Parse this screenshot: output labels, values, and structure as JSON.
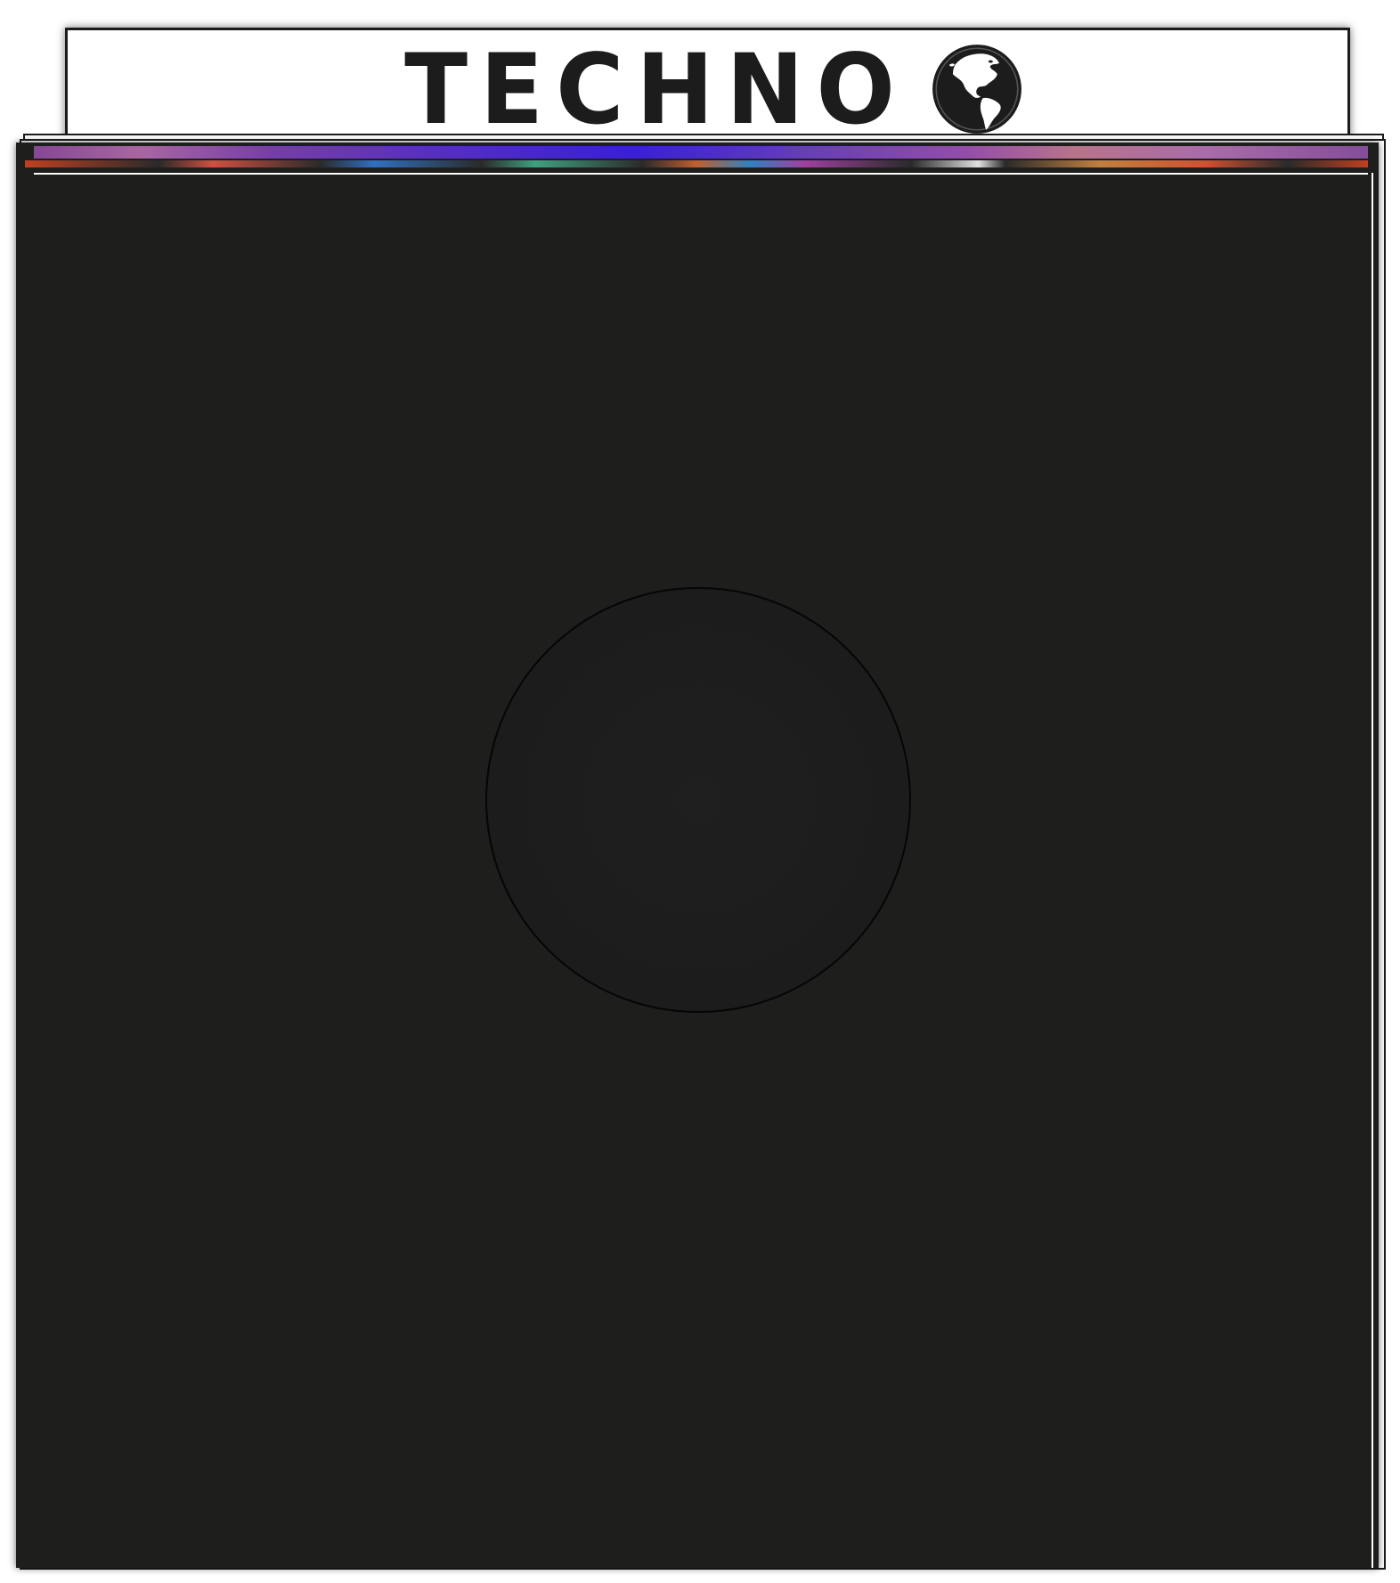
{
  "divider": {
    "title": "TECHNO",
    "icon": "globe-icon"
  },
  "colors": {
    "sleeve": "#1e1e1d",
    "divider_background": "#ffffff",
    "title_text": "#1c1c1c",
    "spine_accent": "#5a30c8"
  }
}
